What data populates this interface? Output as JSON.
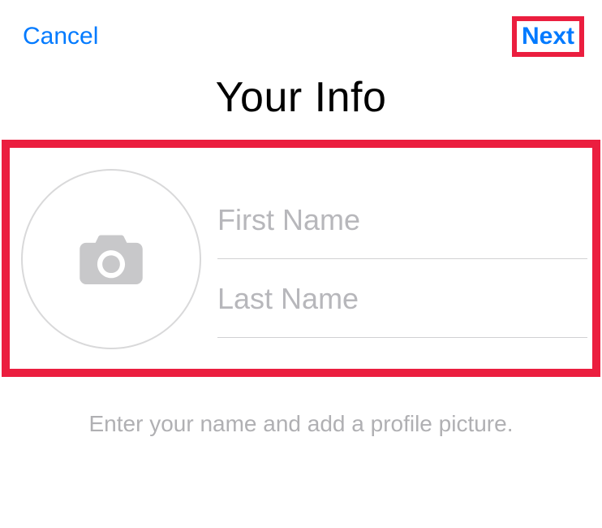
{
  "header": {
    "cancel_label": "Cancel",
    "next_label": "Next"
  },
  "title": "Your Info",
  "form": {
    "first_name": {
      "placeholder": "First Name",
      "value": ""
    },
    "last_name": {
      "placeholder": "Last Name",
      "value": ""
    }
  },
  "hint": "Enter your name and add a profile picture.",
  "highlights": {
    "next_button": true,
    "form_area": true
  },
  "colors": {
    "accent": "#007aff",
    "highlight": "#eb1e3f",
    "placeholder": "#b7b7bb",
    "hint": "#b0b0b3"
  },
  "icons": {
    "avatar_placeholder": "camera-icon"
  }
}
